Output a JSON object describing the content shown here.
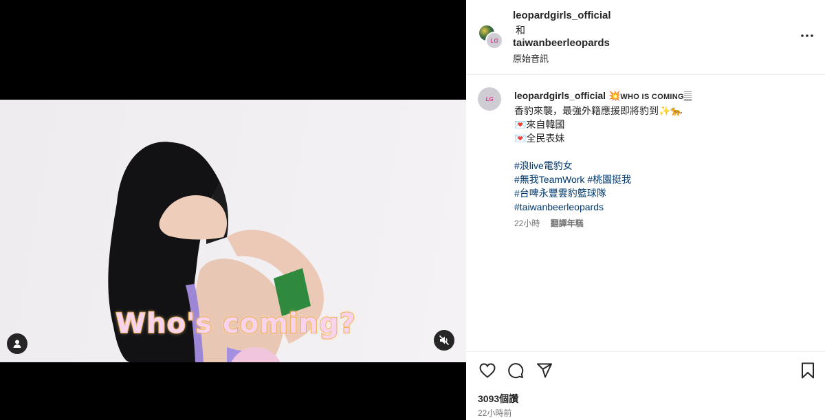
{
  "video": {
    "caption": "Who's coming?"
  },
  "header": {
    "user1": "leopardgirls_official",
    "and_text": "和",
    "user2": "taiwanbeerleopards",
    "audio": "原始音訊",
    "avatar_logo": "LG"
  },
  "post": {
    "username": "leopardgirls_official",
    "headline_emoji": "💥",
    "headline": "WHO IS COMING",
    "headline_end": "𝄛",
    "line1": "香豹來襲，最強外籍應援即將豹到✨🐆",
    "line2": "💌來自韓國",
    "line3": "💌全民表妹",
    "hashtags": [
      "#浪live電豹女",
      "#無我TeamWork #桃園挺我",
      "#台啤永豐雲豹籃球隊",
      "#taiwanbeerleopards"
    ],
    "age": "22小時",
    "translate": "翻譯年糕"
  },
  "footer": {
    "views": "3093個讚",
    "time": "22小時前"
  },
  "icons": {
    "like": "heart-icon",
    "comment": "comment-icon",
    "share": "send-icon",
    "save": "bookmark-icon",
    "more": "more-icon",
    "user": "user-icon",
    "mute": "muted-speaker-icon"
  },
  "colors": {
    "hashtag": "#00376b",
    "secondary_text": "#737373",
    "caption_fill": "#f8d3ec",
    "caption_stroke": "#e8a244"
  }
}
